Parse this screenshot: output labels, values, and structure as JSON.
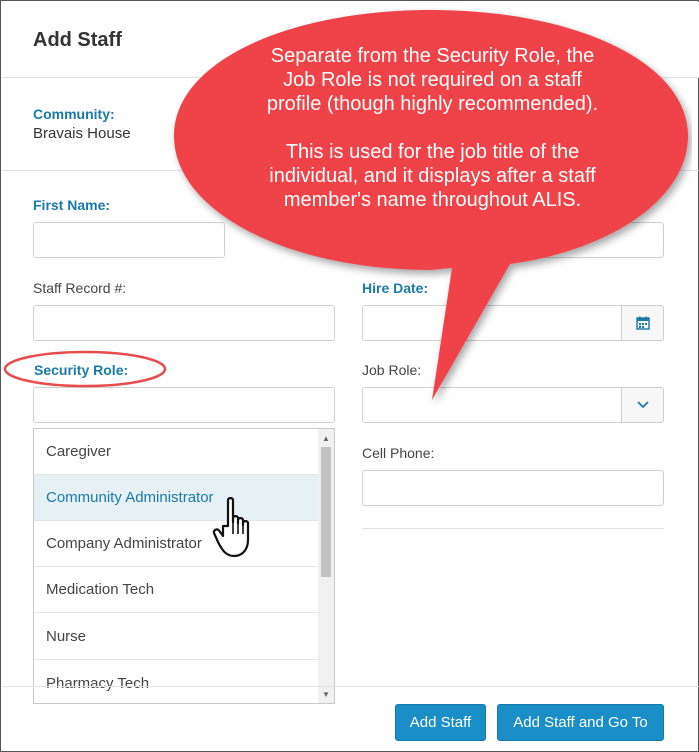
{
  "header": {
    "title": "Add Staff"
  },
  "community": {
    "label": "Community:",
    "value": "Bravais House"
  },
  "form": {
    "first_name_label": "First Name:",
    "staff_record_label": "Staff Record #:",
    "hire_date_label": "Hire Date:",
    "security_role_label": "Security Role:",
    "job_role_label": "Job Role:",
    "cell_phone_label": "Cell Phone:"
  },
  "security_role_options": [
    "Caregiver",
    "Community Administrator",
    "Company Administrator",
    "Medication Tech",
    "Nurse",
    "Pharmacy Tech"
  ],
  "buttons": {
    "add_staff": "Add Staff",
    "add_staff_go_to": "Add Staff and Go To"
  },
  "callout": {
    "paragraph1_lines": [
      "Separate from the Security Role, the",
      "Job Role is not required on a staff",
      "profile (though highly recommended)."
    ],
    "paragraph2_lines": [
      "This is used for the job title of the",
      "individual, and it displays after a staff",
      "member's name throughout ALIS."
    ]
  },
  "colors": {
    "accent": "#1a7aa8",
    "button": "#1a8ec7",
    "callout": "#f04348",
    "highlight_ring": "#e84c4c"
  },
  "icons": {
    "calendar": "calendar-icon",
    "chevron": "chevron-down-icon",
    "cursor": "hand-pointer-icon"
  }
}
